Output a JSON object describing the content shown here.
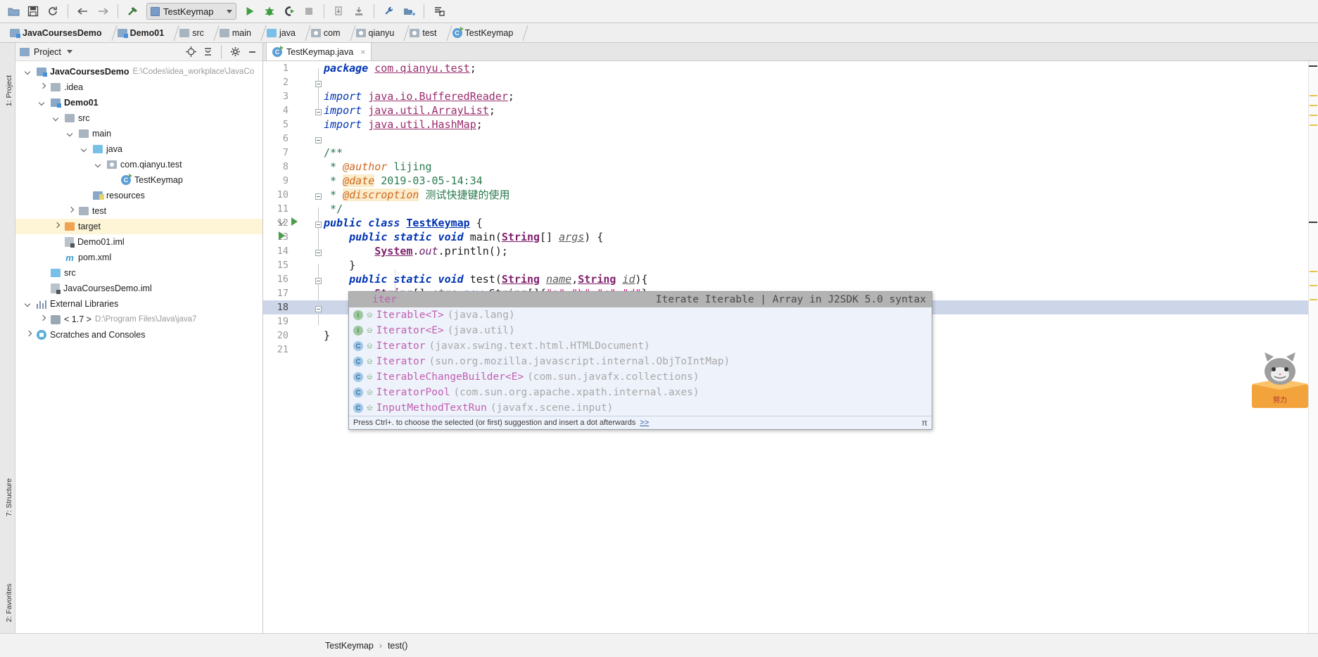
{
  "toolbar": {
    "icons": [
      {
        "name": "open-folder-icon",
        "glyph": "folder"
      },
      {
        "name": "save-all-icon",
        "glyph": "save"
      },
      {
        "name": "sync-icon",
        "glyph": "sync"
      },
      {
        "name": "back-icon",
        "glyph": "←"
      },
      {
        "name": "forward-icon",
        "glyph": "→"
      },
      {
        "name": "build-hammer-icon",
        "glyph": "hammer"
      }
    ],
    "run_config": "TestKeymap",
    "run_icons": [
      {
        "name": "run-icon",
        "glyph": "run"
      },
      {
        "name": "debug-icon",
        "glyph": "bug"
      },
      {
        "name": "run-coverage-icon",
        "glyph": "coverage"
      },
      {
        "name": "stop-icon",
        "glyph": "stop"
      }
    ],
    "right_icons": [
      {
        "name": "update-project-icon",
        "glyph": "update"
      },
      {
        "name": "commit-icon",
        "glyph": "commit"
      },
      {
        "name": "settings-wrench-icon",
        "glyph": "wrench"
      },
      {
        "name": "project-structure-icon",
        "glyph": "structure"
      },
      {
        "name": "attach-icon",
        "glyph": "attach"
      }
    ]
  },
  "breadcrumbs": [
    {
      "label": "JavaCoursesDemo",
      "icon": "module-icon",
      "bold": true
    },
    {
      "label": "Demo01",
      "icon": "module-icon",
      "bold": true
    },
    {
      "label": "src",
      "icon": "folder-icon",
      "bold": false
    },
    {
      "label": "main",
      "icon": "folder-icon",
      "bold": false
    },
    {
      "label": "java",
      "icon": "source-folder-icon",
      "bold": false
    },
    {
      "label": "com",
      "icon": "package-icon",
      "bold": false
    },
    {
      "label": "qianyu",
      "icon": "package-icon",
      "bold": false
    },
    {
      "label": "test",
      "icon": "package-icon",
      "bold": false
    },
    {
      "label": "TestKeymap",
      "icon": "class-icon",
      "bold": false
    }
  ],
  "rail": {
    "project_label": "1: Project",
    "structure_label": "7: Structure",
    "favorites_label": "2: Favorites"
  },
  "project_panel": {
    "title": "Project",
    "header_icons": [
      "locate-icon",
      "collapse-all-icon",
      "settings-icon",
      "hide-icon"
    ],
    "tree": [
      {
        "depth": 0,
        "arrow": "down",
        "icon": "module-icon",
        "label": "JavaCoursesDemo",
        "bold": true,
        "path": "E:\\Codes\\idea_workplace\\JavaCo",
        "highlight": false
      },
      {
        "depth": 1,
        "arrow": "right",
        "icon": "folder-icon",
        "label": ".idea",
        "bold": false,
        "path": "",
        "highlight": false
      },
      {
        "depth": 1,
        "arrow": "down",
        "icon": "module-icon",
        "label": "Demo01",
        "bold": true,
        "path": "",
        "highlight": false
      },
      {
        "depth": 2,
        "arrow": "down",
        "icon": "folder-icon",
        "label": "src",
        "bold": false,
        "path": "",
        "highlight": false
      },
      {
        "depth": 3,
        "arrow": "down",
        "icon": "folder-icon",
        "label": "main",
        "bold": false,
        "path": "",
        "highlight": false
      },
      {
        "depth": 4,
        "arrow": "down",
        "icon": "source-folder-icon",
        "label": "java",
        "bold": false,
        "path": "",
        "highlight": false
      },
      {
        "depth": 5,
        "arrow": "down",
        "icon": "package-icon",
        "label": "com.qianyu.test",
        "bold": false,
        "path": "",
        "highlight": false
      },
      {
        "depth": 6,
        "arrow": "none",
        "icon": "class-icon",
        "label": "TestKeymap",
        "bold": false,
        "path": "",
        "highlight": false
      },
      {
        "depth": 4,
        "arrow": "none",
        "icon": "resources-folder-icon",
        "label": "resources",
        "bold": false,
        "path": "",
        "highlight": false
      },
      {
        "depth": 3,
        "arrow": "right",
        "icon": "folder-icon",
        "label": "test",
        "bold": false,
        "path": "",
        "highlight": false
      },
      {
        "depth": 2,
        "arrow": "right",
        "icon": "target-folder-icon",
        "label": "target",
        "bold": false,
        "path": "",
        "highlight": true
      },
      {
        "depth": 2,
        "arrow": "none",
        "icon": "iml-file-icon",
        "label": "Demo01.iml",
        "bold": false,
        "path": "",
        "highlight": false
      },
      {
        "depth": 2,
        "arrow": "none",
        "icon": "maven-file-icon",
        "label": "pom.xml",
        "bold": false,
        "path": "",
        "highlight": false
      },
      {
        "depth": 1,
        "arrow": "none",
        "icon": "source-folder-icon",
        "label": "src",
        "bold": false,
        "path": "",
        "highlight": false
      },
      {
        "depth": 1,
        "arrow": "none",
        "icon": "iml-file-icon",
        "label": "JavaCoursesDemo.iml",
        "bold": false,
        "path": "",
        "highlight": false
      },
      {
        "depth": 0,
        "arrow": "down",
        "icon": "library-icon",
        "label": "External Libraries",
        "bold": false,
        "path": "",
        "highlight": false
      },
      {
        "depth": 1,
        "arrow": "right",
        "icon": "jdk-icon",
        "label": "< 1.7 >",
        "bold": false,
        "path": "D:\\Program Files\\Java\\java7",
        "highlight": false
      },
      {
        "depth": 0,
        "arrow": "right",
        "icon": "scratches-icon",
        "label": "Scratches and Consoles",
        "bold": false,
        "path": "",
        "highlight": false
      }
    ]
  },
  "editor": {
    "tab": {
      "label": "TestKeymap.java",
      "icon": "java-class-icon",
      "close": "×"
    },
    "lines": [
      {
        "n": "1",
        "tokens": [
          {
            "t": "package ",
            "c": "kw"
          },
          {
            "t": "com.qianyu.test",
            "c": "id-u2"
          },
          {
            "t": ";",
            "c": "plain"
          }
        ]
      },
      {
        "n": "2",
        "tokens": []
      },
      {
        "n": "3",
        "tokens": [
          {
            "t": "import ",
            "c": "kw2"
          },
          {
            "t": "java.io.BufferedReader",
            "c": "id-u2"
          },
          {
            "t": ";",
            "c": "plain"
          }
        ]
      },
      {
        "n": "4",
        "tokens": [
          {
            "t": "import ",
            "c": "kw2"
          },
          {
            "t": "java.util.ArrayList",
            "c": "id-u2"
          },
          {
            "t": ";",
            "c": "plain"
          }
        ]
      },
      {
        "n": "5",
        "tokens": [
          {
            "t": "import ",
            "c": "kw2"
          },
          {
            "t": "java.util.HashMap",
            "c": "id-u2"
          },
          {
            "t": ";",
            "c": "plain"
          }
        ]
      },
      {
        "n": "6",
        "tokens": []
      },
      {
        "n": "7",
        "tokens": [
          {
            "t": "/**",
            "c": "cmt"
          }
        ]
      },
      {
        "n": "8",
        "tokens": [
          {
            "t": " * ",
            "c": "cmt"
          },
          {
            "t": "@author",
            "c": "tag"
          },
          {
            "t": " lijing",
            "c": "cmt"
          }
        ]
      },
      {
        "n": "9",
        "tokens": [
          {
            "t": " * ",
            "c": "cmt"
          },
          {
            "t": "@date",
            "c": "tag-hl"
          },
          {
            "t": " 2019-03-05-14:34",
            "c": "cmt"
          }
        ]
      },
      {
        "n": "10",
        "tokens": [
          {
            "t": " * ",
            "c": "cmt"
          },
          {
            "t": "@discroption",
            "c": "tag-hl"
          },
          {
            "t": " 测试快捷键的使用",
            "c": "cmt"
          }
        ]
      },
      {
        "n": "11",
        "tokens": [
          {
            "t": " */",
            "c": "cmt"
          }
        ]
      },
      {
        "n": "12",
        "tokens": [
          {
            "t": "public class ",
            "c": "kw"
          },
          {
            "t": "TestKeymap",
            "c": "cls-t"
          },
          {
            "t": " {",
            "c": "plain"
          }
        ]
      },
      {
        "n": "13",
        "tokens": [
          {
            "t": "    public static void ",
            "c": "kw"
          },
          {
            "t": "main",
            "c": "meth"
          },
          {
            "t": "(",
            "c": "plain"
          },
          {
            "t": "String",
            "c": "id-u"
          },
          {
            "t": "[] ",
            "c": "plain"
          },
          {
            "t": "args",
            "c": "param"
          },
          {
            "t": ") {",
            "c": "plain"
          }
        ]
      },
      {
        "n": "14",
        "tokens": [
          {
            "t": "        ",
            "c": "plain"
          },
          {
            "t": "System",
            "c": "id-u"
          },
          {
            "t": ".",
            "c": "plain"
          },
          {
            "t": "out",
            "c": "fld"
          },
          {
            "t": ".println();",
            "c": "meth"
          }
        ]
      },
      {
        "n": "15",
        "tokens": [
          {
            "t": "    }",
            "c": "plain"
          }
        ]
      },
      {
        "n": "16",
        "tokens": [
          {
            "t": "    public static void ",
            "c": "kw"
          },
          {
            "t": "test",
            "c": "meth"
          },
          {
            "t": "(",
            "c": "plain"
          },
          {
            "t": "String",
            "c": "id-u"
          },
          {
            "t": " ",
            "c": "plain"
          },
          {
            "t": "name",
            "c": "param"
          },
          {
            "t": ",",
            "c": "plain"
          },
          {
            "t": "String",
            "c": "id-u"
          },
          {
            "t": " ",
            "c": "plain"
          },
          {
            "t": "id",
            "c": "param"
          },
          {
            "t": "){",
            "c": "plain"
          }
        ]
      },
      {
        "n": "17",
        "tokens": [
          {
            "t": "        ",
            "c": "plain"
          },
          {
            "t": "String",
            "c": "id-u"
          },
          {
            "t": "[] ",
            "c": "plain"
          },
          {
            "t": "strs",
            "c": "param"
          },
          {
            "t": "=",
            "c": "plain"
          },
          {
            "t": "new ",
            "c": "kw2"
          },
          {
            "t": "String",
            "c": "plain"
          },
          {
            "t": "[]{",
            "c": "plain"
          },
          {
            "t": "\"a\"",
            "c": "str"
          },
          {
            "t": ",",
            "c": "plain"
          },
          {
            "t": "\"b\"",
            "c": "str"
          },
          {
            "t": ",",
            "c": "plain"
          },
          {
            "t": "\"c\"",
            "c": "str"
          },
          {
            "t": ",",
            "c": "plain"
          },
          {
            "t": "\"d\"",
            "c": "str"
          },
          {
            "t": "};",
            "c": "plain"
          }
        ]
      },
      {
        "n": "18",
        "tokens": [
          {
            "t": "        iter",
            "c": "plain"
          }
        ],
        "current": true
      },
      {
        "n": "19",
        "tokens": []
      },
      {
        "n": "20",
        "tokens": [
          {
            "t": "}",
            "c": "plain"
          }
        ]
      },
      {
        "n": "21",
        "tokens": []
      }
    ]
  },
  "completion": {
    "header_right": "Iterate Iterable | Array in J2SDK 5.0 syntax",
    "selected_label": "iter",
    "items": [
      {
        "icon": "interface-icon",
        "lock": "protected-icon",
        "name": "Iter",
        "match": "able",
        "generic": "<T>",
        "pkg": "(java.lang)"
      },
      {
        "icon": "interface-icon",
        "lock": "protected-icon",
        "name": "Iter",
        "match": "ator",
        "generic": "<E>",
        "pkg": "(java.util)"
      },
      {
        "icon": "class-icon",
        "lock": "protected-icon",
        "name": "Iter",
        "match": "ator",
        "generic": "",
        "pkg": "(javax.swing.text.html.HTMLDocument)"
      },
      {
        "icon": "class-icon",
        "lock": "protected-icon",
        "name": "Iter",
        "match": "ator",
        "generic": "",
        "pkg": "(sun.org.mozilla.javascript.internal.ObjToIntMap)"
      },
      {
        "icon": "class-icon",
        "lock": "protected-icon",
        "name": "Iter",
        "match": "ableChangeBuilder",
        "generic": "<E>",
        "pkg": "(com.sun.javafx.collections)"
      },
      {
        "icon": "class-icon",
        "lock": "protected-icon",
        "name": "Iter",
        "match": "atorPool",
        "generic": "",
        "pkg": "(com.sun.org.apache.xpath.internal.axes)"
      },
      {
        "icon": "class-icon",
        "lock": "protected-icon",
        "name": "InputMethodText",
        "match": "Run",
        "generic": "",
        "pkg": "(javafx.scene.input)"
      }
    ],
    "footer_text": "Press Ctrl+. to choose the selected (or first) suggestion and insert a dot afterwards",
    "footer_link": ">>",
    "footer_icon": "π"
  },
  "status_bar": {
    "class_name": "TestKeymap",
    "separator": "›",
    "method_name": "test()"
  },
  "colors": {
    "accent": "#2b5fa8",
    "keyword": "#0033b3",
    "string": "#e0218a",
    "comment": "#2a7a4f",
    "annotation": "#cf6a22",
    "highlight_row": "#fdf5d6",
    "current_line": "#ccd6e8",
    "popup_bg": "#eef2fb"
  }
}
